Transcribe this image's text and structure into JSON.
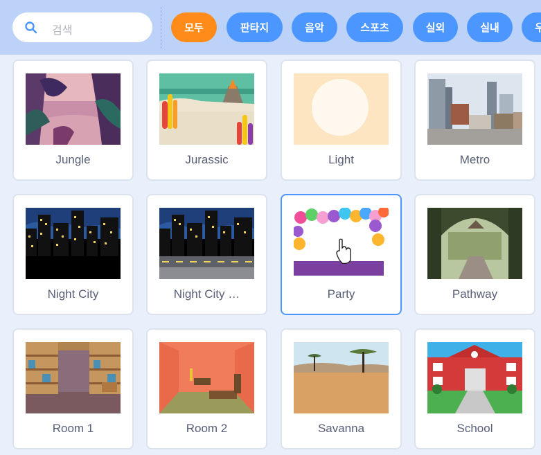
{
  "search": {
    "placeholder": "검색",
    "icon": "search-icon"
  },
  "categories": [
    "모두",
    "판타지",
    "음악",
    "스포츠",
    "실외",
    "실내",
    "우주"
  ],
  "active_category": "모두",
  "backdrops": [
    {
      "name": "Jungle"
    },
    {
      "name": "Jurassic"
    },
    {
      "name": "Light"
    },
    {
      "name": "Metro"
    },
    {
      "name": "Night City"
    },
    {
      "name": "Night City …"
    },
    {
      "name": "Party"
    },
    {
      "name": "Pathway"
    },
    {
      "name": "Room 1"
    },
    {
      "name": "Room 2"
    },
    {
      "name": "Savanna"
    },
    {
      "name": "School"
    }
  ],
  "selected_backdrop": "Party",
  "colors": {
    "topbar": "#bcd2f9",
    "pill": "#4c97ff",
    "pill_active": "#ff8c1a",
    "selected_border": "#4c97ff",
    "label": "#575e75"
  }
}
